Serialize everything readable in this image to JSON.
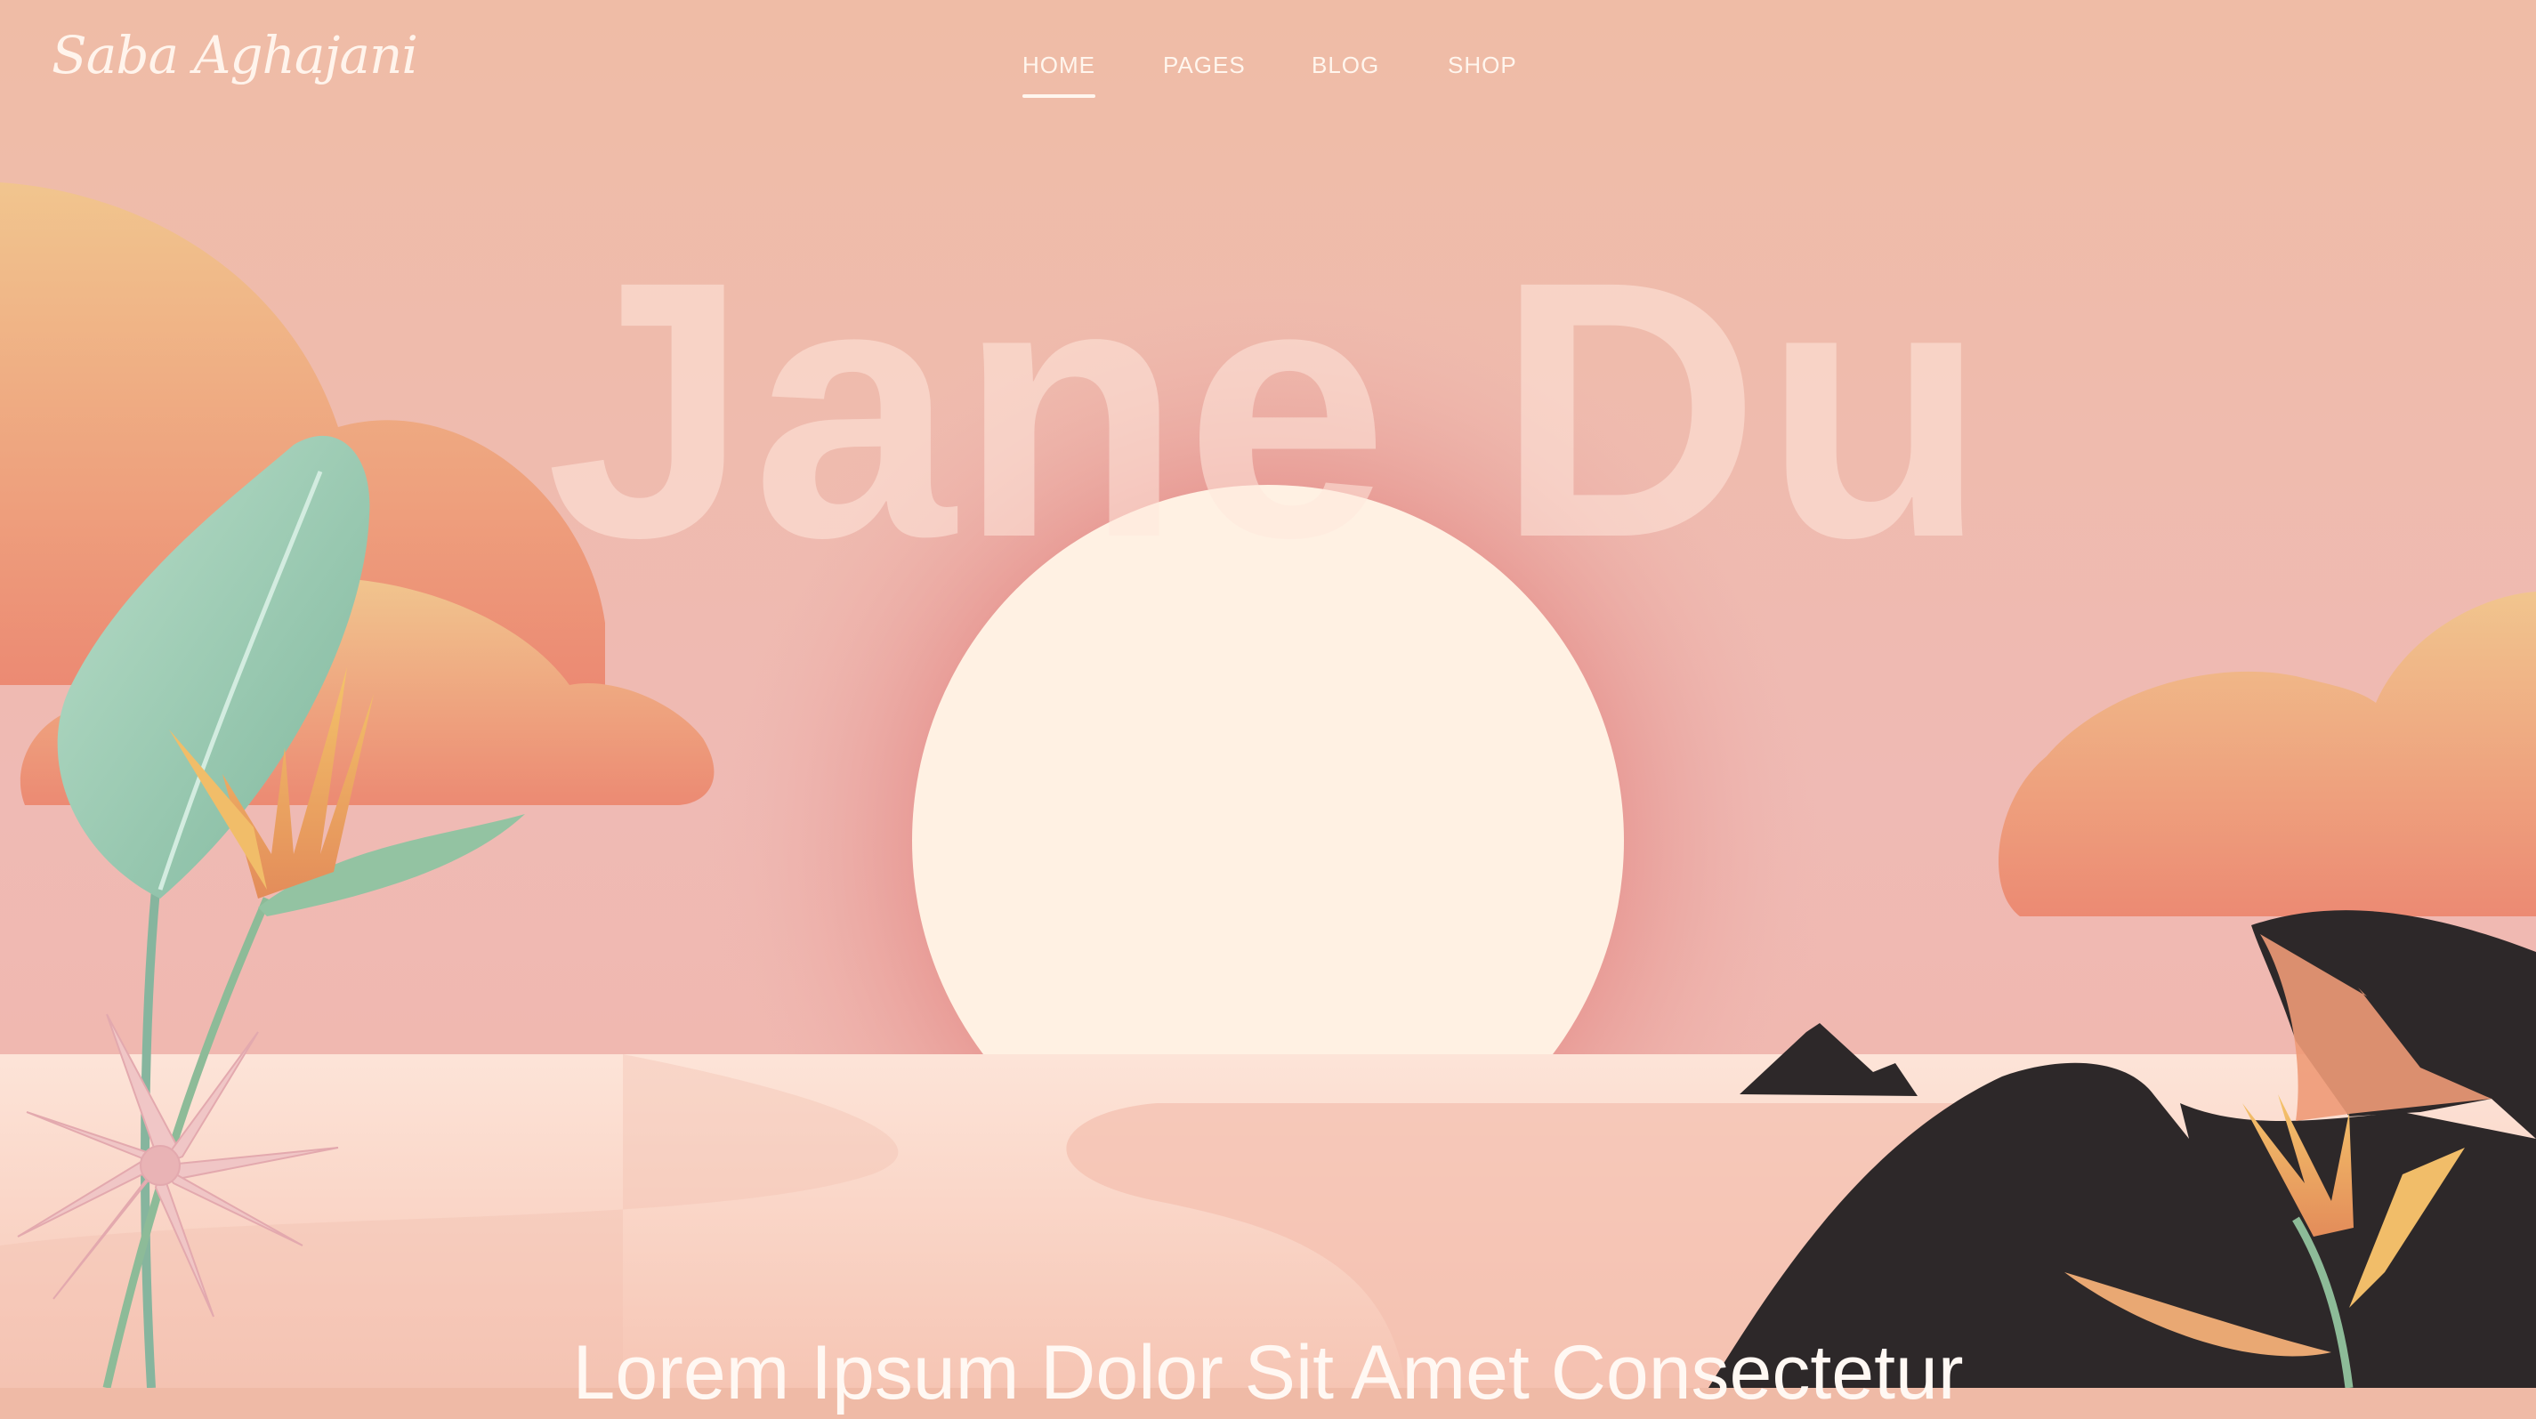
{
  "header": {
    "logo_text": "Saba Aghajani",
    "nav": [
      {
        "label": "HOME",
        "active": true
      },
      {
        "label": "PAGES",
        "active": false
      },
      {
        "label": "BLOG",
        "active": false
      },
      {
        "label": "SHOP",
        "active": false
      }
    ]
  },
  "hero": {
    "title": "Jane Du",
    "subtitle": "Lorem Ipsum Dolor Sit Amet Consectetur"
  },
  "colors": {
    "sky": "#efbaa6",
    "sun": "#fff1e3",
    "cloud": "#ee8f73",
    "water": "#fbd9cc",
    "mountain": "#2d2829",
    "leaf": "#98cbb2",
    "text": "#fff6ee"
  }
}
